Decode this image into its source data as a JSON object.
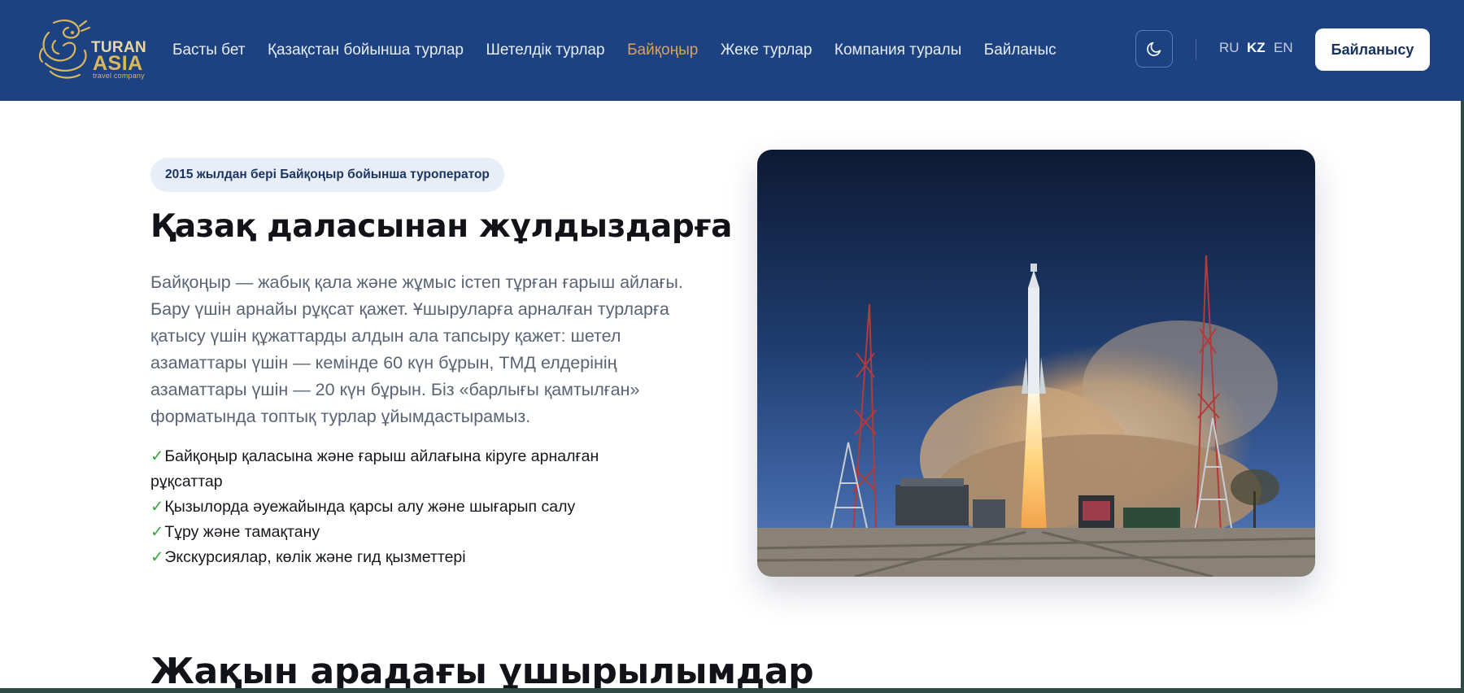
{
  "brand": {
    "line1": "TURAN",
    "line2": "ASIA",
    "tagline": "travel company",
    "gold": "#d9b75c"
  },
  "nav": {
    "items": [
      {
        "label": "Басты бет"
      },
      {
        "label": "Қазақстан бойынша турлар"
      },
      {
        "label": "Шетелдік турлар"
      },
      {
        "label": "Байқоңыр",
        "active": true
      },
      {
        "label": "Жеке турлар"
      },
      {
        "label": "Компания туралы"
      },
      {
        "label": "Байланыс"
      }
    ],
    "theme_icon": "moon-icon",
    "languages": [
      {
        "code": "RU"
      },
      {
        "code": "KZ",
        "active": true
      },
      {
        "code": "EN"
      }
    ],
    "cta_label": "Байланысу"
  },
  "hero": {
    "badge": "2015 жылдан бері Байқоңыр бойынша туроператор",
    "title": "Қазақ даласынан жұлдыздарға",
    "description": "Байқоңыр — жабық қала және жұмыс істеп тұрған ғарыш айлағы. Бару үшін арнайы рұқсат қажет. Ұшыруларға арналған турларға қатысу үшін құжаттарды алдын ала тапсыру қажет: шетел азаматтары үшін — кемінде 60 күн бұрын, ТМД елдерінің азаматтары үшін — 20 күн бұрын. Біз «барлығы қамтылған» форматында топтық турлар ұйымдастырамыз.",
    "check_mark": "✓",
    "features": [
      "Байқоңыр қаласына және ғарыш айлағына кіруге арналған рұқсаттар",
      "Қызылорда әуежайында қарсы алу және шығарып салу",
      "Тұру және тамақтану",
      "Экскурсиялар, көлік және гид қызметтері"
    ],
    "image_icon": "rocket-launch-photo"
  },
  "sections": {
    "launches_title": "Жақын арадағы ұшырылымдар"
  },
  "colors": {
    "header_bg": "#1c4282",
    "accent": "#dba15a",
    "check": "#3aa63f"
  }
}
